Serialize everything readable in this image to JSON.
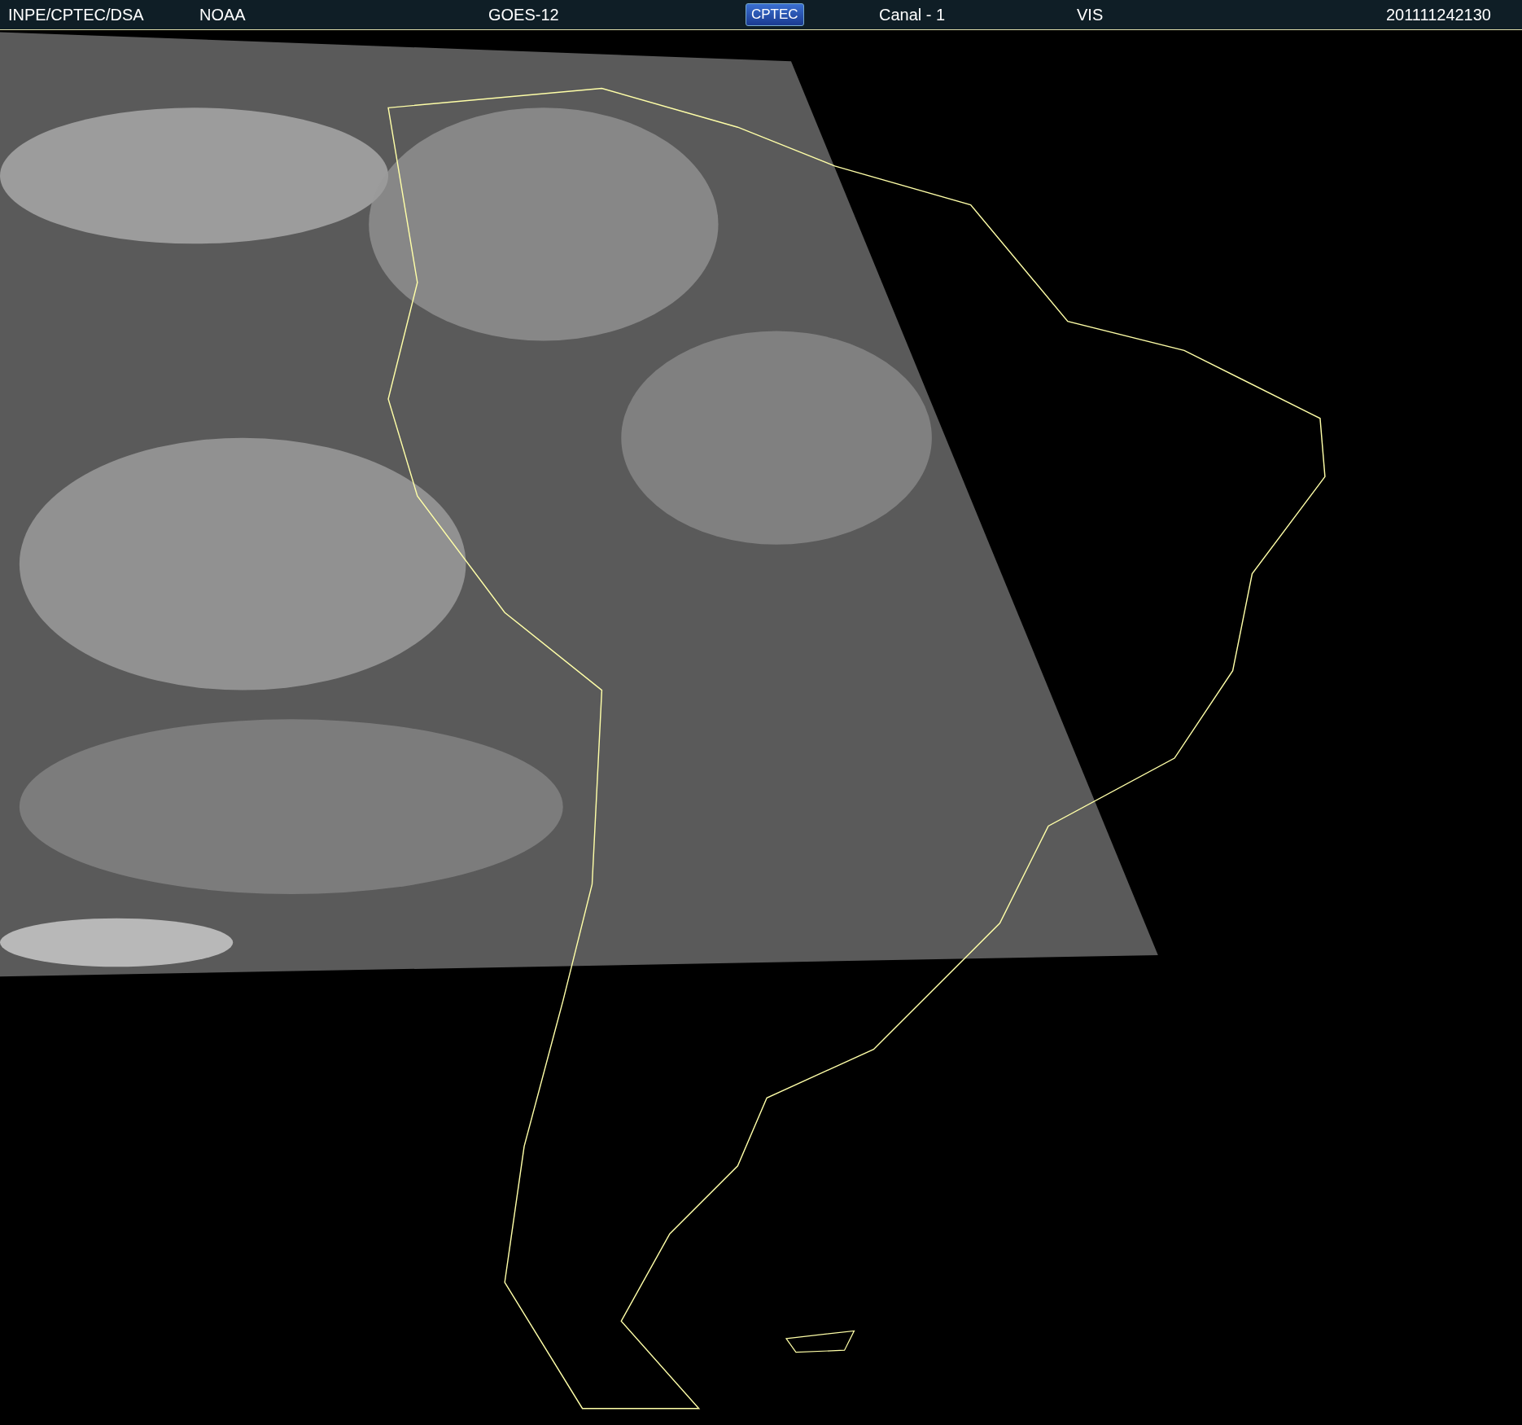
{
  "header": {
    "items": [
      {
        "kind": "text",
        "text": "INPE/CPTEC/DSA"
      },
      {
        "kind": "text",
        "text": "NOAA"
      },
      {
        "kind": "text",
        "text": "GOES-12"
      },
      {
        "kind": "logo",
        "text": "CPTEC"
      },
      {
        "kind": "text",
        "text": "Canal - 1"
      },
      {
        "kind": "text",
        "text": "VIS"
      },
      {
        "kind": "text",
        "text": "201111242130"
      }
    ]
  }
}
